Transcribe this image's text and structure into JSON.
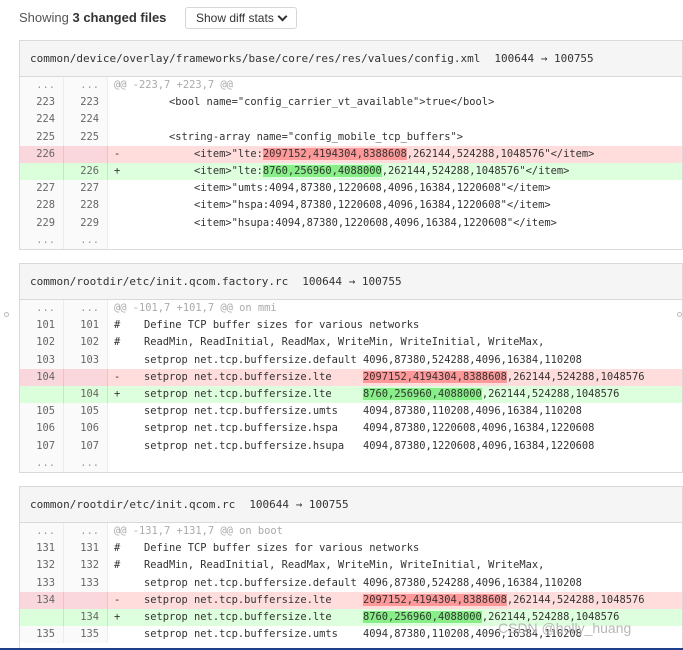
{
  "summary": {
    "prefix": "Showing ",
    "count": "3 changed files",
    "diffstat_button": "Show diff stats"
  },
  "files": [
    {
      "path": "common/device/overlay/frameworks/base/core/res/res/values/config.xml",
      "mode": "100644 → 100755",
      "lines": [
        {
          "type": "hunk",
          "old": "...",
          "new": "...",
          "sign": "",
          "pre": "@@ -223,7 +223,7 @@",
          "hl": "",
          "post": ""
        },
        {
          "type": "ctx",
          "old": "223",
          "new": "223",
          "sign": "",
          "pre": "    <bool name=\"config_carrier_vt_available\">true</bool>",
          "hl": "",
          "post": ""
        },
        {
          "type": "ctx",
          "old": "224",
          "new": "224",
          "sign": "",
          "pre": "",
          "hl": "",
          "post": ""
        },
        {
          "type": "ctx",
          "old": "225",
          "new": "225",
          "sign": "",
          "pre": "    <string-array name=\"config_mobile_tcp_buffers\">",
          "hl": "",
          "post": ""
        },
        {
          "type": "del",
          "old": "226",
          "new": "",
          "sign": "-",
          "pre": "        <item>\"lte:",
          "hl": "2097152,4194304,8388608",
          "post": ",262144,524288,1048576\"</item>"
        },
        {
          "type": "add",
          "old": "",
          "new": "226",
          "sign": "+",
          "pre": "        <item>\"lte:",
          "hl": "8760,256960,4088000",
          "post": ",262144,524288,1048576\"</item>"
        },
        {
          "type": "ctx",
          "old": "227",
          "new": "227",
          "sign": "",
          "pre": "        <item>\"umts:4094,87380,1220608,4096,16384,1220608\"</item>",
          "hl": "",
          "post": ""
        },
        {
          "type": "ctx",
          "old": "228",
          "new": "228",
          "sign": "",
          "pre": "        <item>\"hspa:4094,87380,1220608,4096,16384,1220608\"</item>",
          "hl": "",
          "post": ""
        },
        {
          "type": "ctx",
          "old": "229",
          "new": "229",
          "sign": "",
          "pre": "        <item>\"hsupa:4094,87380,1220608,4096,16384,1220608\"</item>",
          "hl": "",
          "post": ""
        },
        {
          "type": "hunk",
          "old": "...",
          "new": "...",
          "sign": "",
          "pre": "",
          "hl": "",
          "post": ""
        }
      ]
    },
    {
      "path": "common/rootdir/etc/init.qcom.factory.rc",
      "mode": "100644 → 100755",
      "lines": [
        {
          "type": "hunk",
          "old": "...",
          "new": "...",
          "sign": "",
          "pre": "@@ -101,7 +101,7 @@ on mmi",
          "hl": "",
          "post": ""
        },
        {
          "type": "ctx",
          "old": "101",
          "new": "101",
          "sign": "#",
          "pre": "Define TCP buffer sizes for various networks",
          "hl": "",
          "post": ""
        },
        {
          "type": "ctx",
          "old": "102",
          "new": "102",
          "sign": "#",
          "pre": "ReadMin, ReadInitial, ReadMax, WriteMin, WriteInitial, WriteMax,",
          "hl": "",
          "post": ""
        },
        {
          "type": "ctx",
          "old": "103",
          "new": "103",
          "sign": "",
          "pre": "setprop net.tcp.buffersize.default 4096,87380,524288,4096,16384,110208",
          "hl": "",
          "post": ""
        },
        {
          "type": "del",
          "old": "104",
          "new": "",
          "sign": "-",
          "pre": "setprop net.tcp.buffersize.lte     ",
          "hl": "2097152,4194304,8388608",
          "post": ",262144,524288,1048576"
        },
        {
          "type": "add",
          "old": "",
          "new": "104",
          "sign": "+",
          "pre": "setprop net.tcp.buffersize.lte     ",
          "hl": "8760,256960,4088000",
          "post": ",262144,524288,1048576"
        },
        {
          "type": "ctx",
          "old": "105",
          "new": "105",
          "sign": "",
          "pre": "setprop net.tcp.buffersize.umts    4094,87380,110208,4096,16384,110208",
          "hl": "",
          "post": ""
        },
        {
          "type": "ctx",
          "old": "106",
          "new": "106",
          "sign": "",
          "pre": "setprop net.tcp.buffersize.hspa    4094,87380,1220608,4096,16384,1220608",
          "hl": "",
          "post": ""
        },
        {
          "type": "ctx",
          "old": "107",
          "new": "107",
          "sign": "",
          "pre": "setprop net.tcp.buffersize.hsupa   4094,87380,1220608,4096,16384,1220608",
          "hl": "",
          "post": ""
        },
        {
          "type": "hunk",
          "old": "...",
          "new": "...",
          "sign": "",
          "pre": "",
          "hl": "",
          "post": ""
        }
      ]
    },
    {
      "path": "common/rootdir/etc/init.qcom.rc",
      "mode": "100644 → 100755",
      "lines": [
        {
          "type": "hunk",
          "old": "...",
          "new": "...",
          "sign": "",
          "pre": "@@ -131,7 +131,7 @@ on boot",
          "hl": "",
          "post": ""
        },
        {
          "type": "ctx",
          "old": "131",
          "new": "131",
          "sign": "#",
          "pre": "Define TCP buffer sizes for various networks",
          "hl": "",
          "post": ""
        },
        {
          "type": "ctx",
          "old": "132",
          "new": "132",
          "sign": "#",
          "pre": "ReadMin, ReadInitial, ReadMax, WriteMin, WriteInitial, WriteMax,",
          "hl": "",
          "post": ""
        },
        {
          "type": "ctx",
          "old": "133",
          "new": "133",
          "sign": "",
          "pre": "setprop net.tcp.buffersize.default 4096,87380,524288,4096,16384,110208",
          "hl": "",
          "post": ""
        },
        {
          "type": "del",
          "old": "134",
          "new": "",
          "sign": "-",
          "pre": "setprop net.tcp.buffersize.lte     ",
          "hl": "2097152,4194304,8388608",
          "post": ",262144,524288,1048576"
        },
        {
          "type": "add",
          "old": "",
          "new": "134",
          "sign": "+",
          "pre": "setprop net.tcp.buffersize.lte     ",
          "hl": "8760,256960,4088000",
          "post": ",262144,524288,1048576"
        },
        {
          "type": "ctx",
          "old": "135",
          "new": "135",
          "sign": "",
          "pre": "setprop net.tcp.buffersize.umts    4094,87380,110208,4096,16384,110208",
          "hl": "",
          "post": ""
        }
      ]
    }
  ],
  "watermark": "CSDN @holly_huang",
  "colors": {
    "del_bg": "#ffdddd",
    "del_hl": "#ff9999",
    "add_bg": "#ddffdd",
    "add_hl": "#88ee88"
  }
}
